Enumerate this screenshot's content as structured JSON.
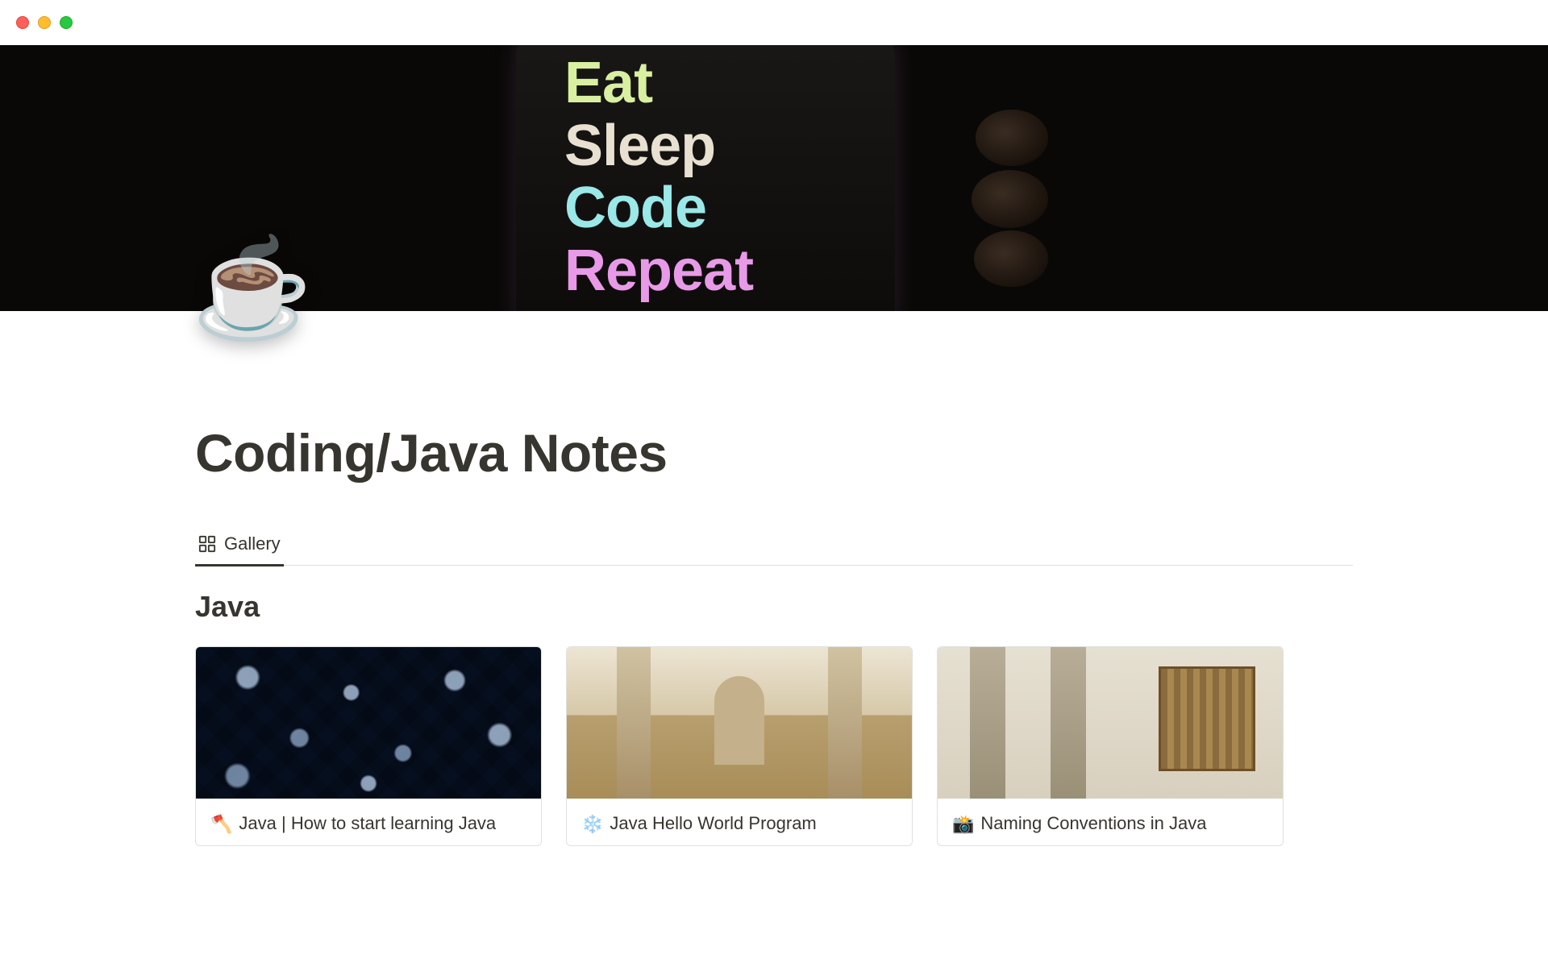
{
  "cover": {
    "words": [
      "Eat",
      "Sleep",
      "Code",
      "Repeat"
    ]
  },
  "page": {
    "icon": "☕",
    "title": "Coding/Java Notes"
  },
  "view": {
    "tab_label": "Gallery"
  },
  "group": {
    "heading": "Java"
  },
  "cards": [
    {
      "emoji": "🪓",
      "title": "Java | How to start learning Java"
    },
    {
      "emoji": "❄️",
      "title": "Java Hello World Program"
    },
    {
      "emoji": "📸",
      "title": "Naming Conventions in Java"
    }
  ]
}
